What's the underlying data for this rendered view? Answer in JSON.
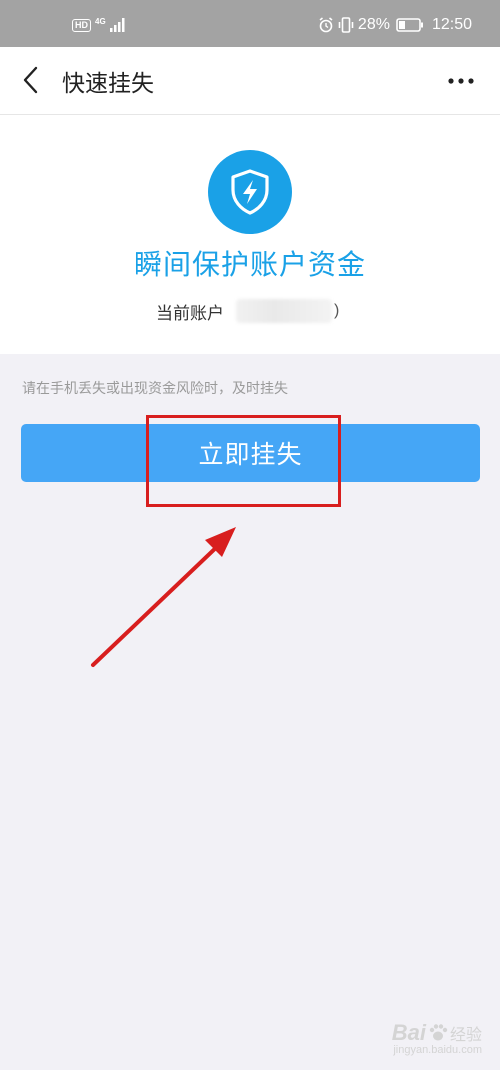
{
  "status_bar": {
    "hd_badge": "HD",
    "network_type": "4G",
    "battery_percent": "28%",
    "time": "12:50",
    "icons": [
      "hd-icon",
      "signal-icon",
      "alarm-icon",
      "vibrate-icon",
      "battery-icon"
    ]
  },
  "nav": {
    "back_icon": "chevron-left-icon",
    "title": "快速挂失",
    "more_icon": "more-horizontal-icon"
  },
  "hero": {
    "icon": "shield-lightning-icon",
    "title": "瞬间保护账户资金",
    "account_label": "当前账户",
    "account_value_tail": ")"
  },
  "hint": "请在手机丢失或出现资金风险时，及时挂失",
  "report_button": {
    "label": "立即挂失"
  },
  "watermark": {
    "brand_left": "Bai",
    "brand_right": "经验",
    "url": "jingyan.baidu.com"
  },
  "colors": {
    "status_bar_bg": "#a3a3a3",
    "accent_blue": "#1aa1e7",
    "button_blue": "#45a6f6",
    "page_bg": "#f2f1f6",
    "annotation_red": "#d81e1e"
  }
}
